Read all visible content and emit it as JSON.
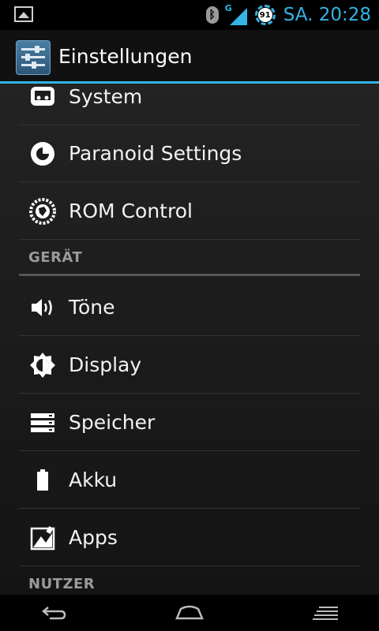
{
  "status_bar": {
    "time": "SA. 20:28",
    "battery_level": "91",
    "network_type": "G"
  },
  "action_bar": {
    "title": "Einstellungen"
  },
  "list": {
    "items_top": [
      {
        "label": "System",
        "icon": "system-icon"
      },
      {
        "label": "Paranoid Settings",
        "icon": "paranoid-icon"
      },
      {
        "label": "ROM Control",
        "icon": "rom-control-icon"
      }
    ],
    "section_geraet": "GERÄT",
    "items_device": [
      {
        "label": "Töne",
        "icon": "speaker-icon"
      },
      {
        "label": "Display",
        "icon": "brightness-icon"
      },
      {
        "label": "Speicher",
        "icon": "storage-icon"
      },
      {
        "label": "Akku",
        "icon": "battery-icon"
      },
      {
        "label": "Apps",
        "icon": "apps-icon"
      }
    ],
    "section_nutzer": "NUTZER"
  },
  "colors": {
    "accent": "#33b5e5",
    "background": "#1b1b1b",
    "divider": "#333333"
  }
}
